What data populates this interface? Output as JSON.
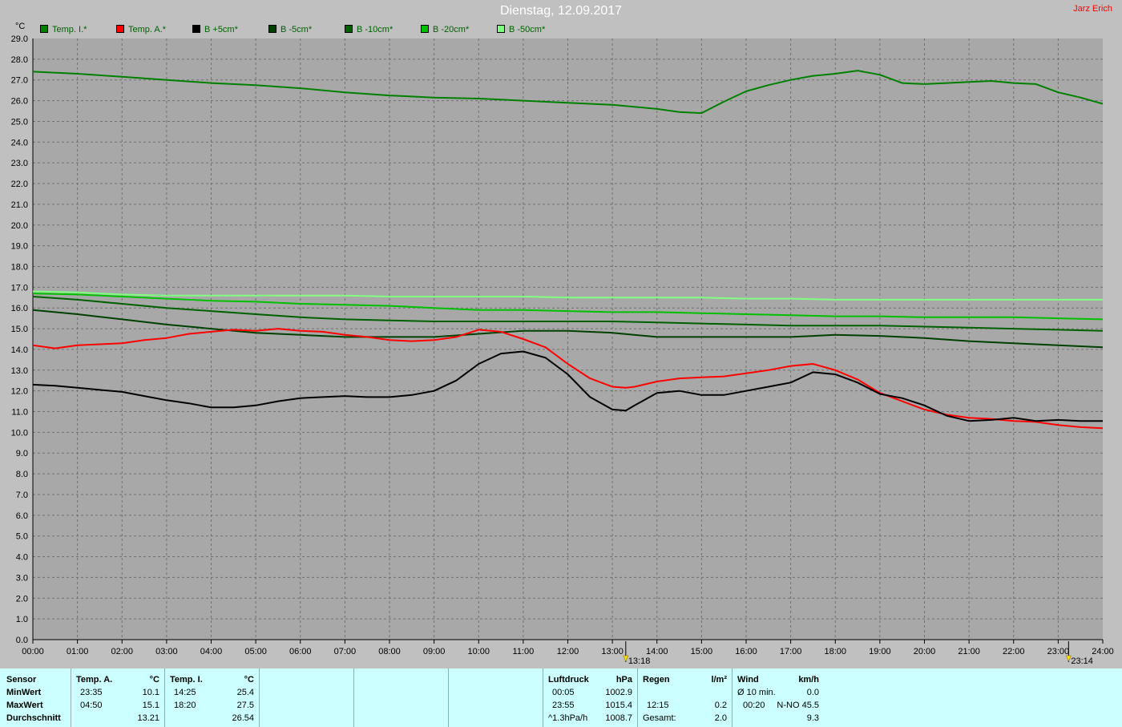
{
  "header": {
    "title": "Dienstag, 12.09.2017",
    "author": "Jarz Erich",
    "y_unit": "°C"
  },
  "chart_data": {
    "type": "line",
    "ylim": [
      0,
      29
    ],
    "yticks": [
      "0.0",
      "1.0",
      "2.0",
      "3.0",
      "4.0",
      "5.0",
      "6.0",
      "7.0",
      "8.0",
      "9.0",
      "10.0",
      "11.0",
      "12.0",
      "13.0",
      "14.0",
      "15.0",
      "16.0",
      "17.0",
      "18.0",
      "19.0",
      "20.0",
      "21.0",
      "22.0",
      "23.0",
      "24.0",
      "25.0",
      "26.0",
      "27.0",
      "28.0",
      "29.0"
    ],
    "xlim": [
      0,
      24
    ],
    "xticks": [
      "00:00",
      "01:00",
      "02:00",
      "03:00",
      "04:00",
      "05:00",
      "06:00",
      "07:00",
      "08:00",
      "09:00",
      "10:00",
      "11:00",
      "12:00",
      "13:00",
      "14:00",
      "15:00",
      "16:00",
      "17:00",
      "18:00",
      "19:00",
      "20:00",
      "21:00",
      "22:00",
      "23:00",
      "24:00"
    ],
    "grid": true,
    "legend_position": "top-left",
    "markers": [
      {
        "x": 13.3,
        "label": "13:18"
      },
      {
        "x": 23.233,
        "label": "23:14"
      }
    ],
    "series": [
      {
        "name": "Temp. I.*",
        "color": "#008000",
        "x": [
          0,
          1,
          2,
          3,
          4,
          5,
          6,
          7,
          8,
          9,
          10,
          11,
          12,
          13,
          14,
          14.5,
          15,
          15.5,
          16,
          16.5,
          17,
          17.5,
          18,
          18.5,
          19,
          19.5,
          20,
          20.5,
          21,
          21.5,
          22,
          22.5,
          23,
          23.5,
          24
        ],
        "y": [
          27.4,
          27.3,
          27.15,
          27.0,
          26.85,
          26.75,
          26.6,
          26.4,
          26.25,
          26.15,
          26.1,
          26.0,
          25.9,
          25.8,
          25.6,
          25.45,
          25.4,
          25.95,
          26.45,
          26.75,
          27.0,
          27.2,
          27.3,
          27.45,
          27.25,
          26.85,
          26.8,
          26.85,
          26.9,
          26.95,
          26.85,
          26.8,
          26.4,
          26.15,
          25.85
        ]
      },
      {
        "name": "Temp. A.*",
        "color": "#ff0000",
        "x": [
          0,
          0.5,
          1,
          1.5,
          2,
          2.5,
          3,
          3.5,
          4,
          4.5,
          5,
          5.5,
          6,
          6.5,
          7,
          7.5,
          8,
          8.5,
          9,
          9.5,
          10,
          10.5,
          11,
          11.5,
          12,
          12.5,
          13,
          13.3,
          13.5,
          14,
          14.5,
          15,
          15.5,
          16,
          16.5,
          17,
          17.5,
          18,
          18.5,
          19,
          19.5,
          20,
          20.5,
          21,
          21.5,
          22,
          22.5,
          23,
          23.5,
          24
        ],
        "y": [
          14.2,
          14.05,
          14.2,
          14.25,
          14.3,
          14.45,
          14.55,
          14.75,
          14.85,
          14.95,
          14.9,
          15.0,
          14.9,
          14.85,
          14.7,
          14.6,
          14.45,
          14.4,
          14.45,
          14.6,
          14.95,
          14.85,
          14.5,
          14.1,
          13.3,
          12.6,
          12.2,
          12.15,
          12.2,
          12.45,
          12.6,
          12.65,
          12.7,
          12.85,
          13.0,
          13.2,
          13.3,
          13.0,
          12.55,
          11.9,
          11.5,
          11.1,
          10.85,
          10.7,
          10.65,
          10.55,
          10.5,
          10.35,
          10.25,
          10.2
        ]
      },
      {
        "name": "B +5cm*",
        "color": "#000000",
        "x": [
          0,
          0.5,
          1,
          1.5,
          2,
          2.5,
          3,
          3.5,
          4,
          4.5,
          5,
          5.5,
          6,
          6.5,
          7,
          7.5,
          8,
          8.5,
          9,
          9.5,
          10,
          10.5,
          11,
          11.5,
          12,
          12.5,
          13,
          13.3,
          13.5,
          14,
          14.5,
          15,
          15.5,
          16,
          16.5,
          17,
          17.5,
          18,
          18.5,
          19,
          19.5,
          20,
          20.5,
          21,
          21.5,
          22,
          22.5,
          23,
          23.5,
          24
        ],
        "y": [
          12.3,
          12.25,
          12.15,
          12.05,
          11.95,
          11.75,
          11.55,
          11.4,
          11.2,
          11.2,
          11.3,
          11.5,
          11.65,
          11.7,
          11.75,
          11.7,
          11.7,
          11.8,
          12.0,
          12.5,
          13.3,
          13.8,
          13.9,
          13.6,
          12.8,
          11.7,
          11.1,
          11.05,
          11.3,
          11.9,
          12.0,
          11.8,
          11.8,
          12.0,
          12.2,
          12.4,
          12.9,
          12.8,
          12.4,
          11.85,
          11.65,
          11.3,
          10.8,
          10.55,
          10.6,
          10.7,
          10.55,
          10.6,
          10.55,
          10.55
        ]
      },
      {
        "name": "B -5cm*",
        "color": "#004000",
        "x": [
          0,
          1,
          2,
          3,
          4,
          5,
          6,
          7,
          8,
          9,
          10,
          11,
          12,
          13,
          14,
          15,
          16,
          17,
          18,
          19,
          20,
          21,
          22,
          23,
          24
        ],
        "y": [
          15.9,
          15.7,
          15.45,
          15.2,
          15.0,
          14.8,
          14.7,
          14.6,
          14.6,
          14.6,
          14.75,
          14.9,
          14.9,
          14.8,
          14.6,
          14.6,
          14.6,
          14.6,
          14.7,
          14.65,
          14.55,
          14.4,
          14.3,
          14.2,
          14.1
        ]
      },
      {
        "name": "B -10cm*",
        "color": "#006000",
        "x": [
          0,
          1,
          2,
          3,
          4,
          5,
          6,
          7,
          8,
          9,
          10,
          11,
          12,
          13,
          14,
          15,
          16,
          17,
          18,
          19,
          20,
          21,
          22,
          23,
          24
        ],
        "y": [
          16.55,
          16.4,
          16.2,
          16.0,
          15.85,
          15.7,
          15.55,
          15.45,
          15.4,
          15.35,
          15.35,
          15.35,
          15.35,
          15.35,
          15.3,
          15.25,
          15.2,
          15.15,
          15.15,
          15.15,
          15.1,
          15.05,
          15.0,
          14.95,
          14.9
        ]
      },
      {
        "name": "B -20cm*",
        "color": "#00c000",
        "x": [
          0,
          1,
          2,
          3,
          4,
          5,
          6,
          7,
          8,
          9,
          10,
          11,
          12,
          13,
          14,
          15,
          16,
          17,
          18,
          19,
          20,
          21,
          22,
          23,
          24
        ],
        "y": [
          16.7,
          16.65,
          16.55,
          16.45,
          16.35,
          16.3,
          16.2,
          16.15,
          16.1,
          16.0,
          15.9,
          15.9,
          15.85,
          15.8,
          15.8,
          15.75,
          15.7,
          15.65,
          15.6,
          15.6,
          15.55,
          15.55,
          15.55,
          15.5,
          15.45
        ]
      },
      {
        "name": "B -50cm*",
        "color": "#80ff80",
        "x": [
          0,
          1,
          2,
          3,
          4,
          5,
          6,
          7,
          8,
          9,
          10,
          11,
          12,
          13,
          14,
          15,
          16,
          17,
          18,
          19,
          20,
          21,
          22,
          23,
          24
        ],
        "y": [
          16.8,
          16.75,
          16.65,
          16.6,
          16.6,
          16.6,
          16.6,
          16.6,
          16.55,
          16.55,
          16.55,
          16.55,
          16.5,
          16.5,
          16.5,
          16.5,
          16.45,
          16.45,
          16.4,
          16.4,
          16.4,
          16.4,
          16.4,
          16.4,
          16.4
        ]
      }
    ]
  },
  "stats": {
    "sensor": {
      "label": "Sensor",
      "rows": [
        "MinWert",
        "MaxWert",
        "Durchschnitt"
      ]
    },
    "temp_a": {
      "label": "Temp. A.",
      "unit": "°C",
      "min_time": "23:35",
      "min_val": "10.1",
      "max_time": "04:50",
      "max_val": "15.1",
      "avg": "13.21"
    },
    "temp_i": {
      "label": "Temp. I.",
      "unit": "°C",
      "min_time": "14:25",
      "min_val": "25.4",
      "max_time": "18:20",
      "max_val": "27.5",
      "avg": "26.54"
    },
    "pressure": {
      "label": "Luftdruck",
      "unit": "hPa",
      "min_time": "00:05",
      "min_val": "1002.9",
      "max_time": "23:55",
      "max_val": "1015.4",
      "trend": "^1.3hPa/h",
      "avg": "1008.7"
    },
    "rain": {
      "label": "Regen",
      "unit": "l/m²",
      "max_time": "12:15",
      "max_val": "0.2",
      "total_label": "Gesamt:",
      "total": "2.0"
    },
    "wind": {
      "label": "Wind",
      "unit": "km/h",
      "avg10_label": "Ø 10 min.",
      "avg10": "0.0",
      "max_time": "00:20",
      "max_dir_val": "N-NO 45.5",
      "avg": "9.3"
    }
  }
}
